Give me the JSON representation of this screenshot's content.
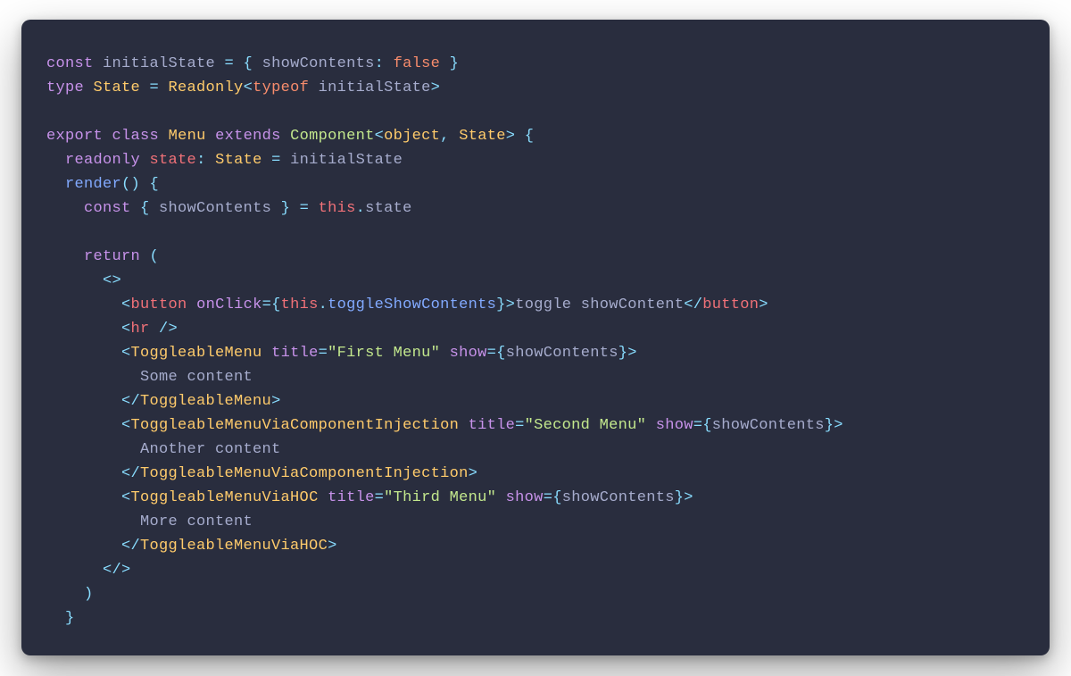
{
  "line1": {
    "t0": "const ",
    "t1": "initialState ",
    "t2": "= { ",
    "t3": "showContents",
    "t4": ":",
    "t5": " ",
    "t6": "false",
    "t7": " }"
  },
  "line2": {
    "t0": "type ",
    "t1": "State ",
    "t2": "= ",
    "t3": "Readonly",
    "t4": "<",
    "t5": "typeof",
    "t6": " ",
    "t7": "initialState",
    "t8": ">"
  },
  "line4": {
    "t0": "export",
    "t1": " ",
    "t2": "class",
    "t3": " ",
    "t4": "Menu",
    "t5": " ",
    "t6": "extends",
    "t7": " ",
    "t8": "Component",
    "t9": "<",
    "t10": "object",
    "t11": ", ",
    "t12": "State",
    "t13": ">",
    "t14": " {"
  },
  "line5": {
    "t0": "  ",
    "t1": "readonly",
    "t2": " ",
    "t3": "state",
    "t4": ": ",
    "t5": "State",
    "t6": " = ",
    "t7": "initialState"
  },
  "line6": {
    "t0": "  ",
    "t1": "render",
    "t2": "() {"
  },
  "line7": {
    "t0": "    ",
    "t1": "const",
    "t2": " { ",
    "t3": "showContents",
    "t4": " } = ",
    "t5": "this",
    "t6": ".",
    "t7": "state"
  },
  "line9": {
    "t0": "    ",
    "t1": "return",
    "t2": " ("
  },
  "line10": {
    "t0": "      ",
    "t1": "<>"
  },
  "line11": {
    "t0": "        ",
    "t1": "<",
    "t2": "button",
    "t3": " ",
    "t4": "onClick",
    "t5": "={",
    "t6": "this",
    "t7": ".",
    "t8": "toggleShowContents",
    "t9": "}",
    "t10": ">",
    "t11": "toggle showContent",
    "t12": "</",
    "t13": "button",
    "t14": ">"
  },
  "line12": {
    "t0": "        ",
    "t1": "<",
    "t2": "hr",
    "t3": " />"
  },
  "line13": {
    "t0": "        ",
    "t1": "<",
    "t2": "ToggleableMenu",
    "t3": " ",
    "t4": "title",
    "t5": "=",
    "t6": "\"First Menu\"",
    "t7": " ",
    "t8": "show",
    "t9": "={",
    "t10": "showContents",
    "t11": "}",
    "t12": ">"
  },
  "line14": {
    "t0": "          ",
    "t1": "Some content"
  },
  "line15": {
    "t0": "        ",
    "t1": "</",
    "t2": "ToggleableMenu",
    "t3": ">"
  },
  "line16": {
    "t0": "        ",
    "t1": "<",
    "t2": "ToggleableMenuViaComponentInjection",
    "t3": " ",
    "t4": "title",
    "t5": "=",
    "t6": "\"Second Menu\"",
    "t7": " ",
    "t8": "show",
    "t9": "={",
    "t10": "showContents",
    "t11": "}>"
  },
  "line17": {
    "t0": "          ",
    "t1": "Another content"
  },
  "line18": {
    "t0": "        ",
    "t1": "</",
    "t2": "ToggleableMenuViaComponentInjection",
    "t3": ">"
  },
  "line19": {
    "t0": "        ",
    "t1": "<",
    "t2": "ToggleableMenuViaHOC",
    "t3": " ",
    "t4": "title",
    "t5": "=",
    "t6": "\"Third Menu\"",
    "t7": " ",
    "t8": "show",
    "t9": "={",
    "t10": "showContents",
    "t11": "}>"
  },
  "line20": {
    "t0": "          ",
    "t1": "More content"
  },
  "line21": {
    "t0": "        ",
    "t1": "</",
    "t2": "ToggleableMenuViaHOC",
    "t3": ">"
  },
  "line22": {
    "t0": "      ",
    "t1": "</>"
  },
  "line23": {
    "t0": "    )"
  },
  "line24": {
    "t0": "  }"
  }
}
